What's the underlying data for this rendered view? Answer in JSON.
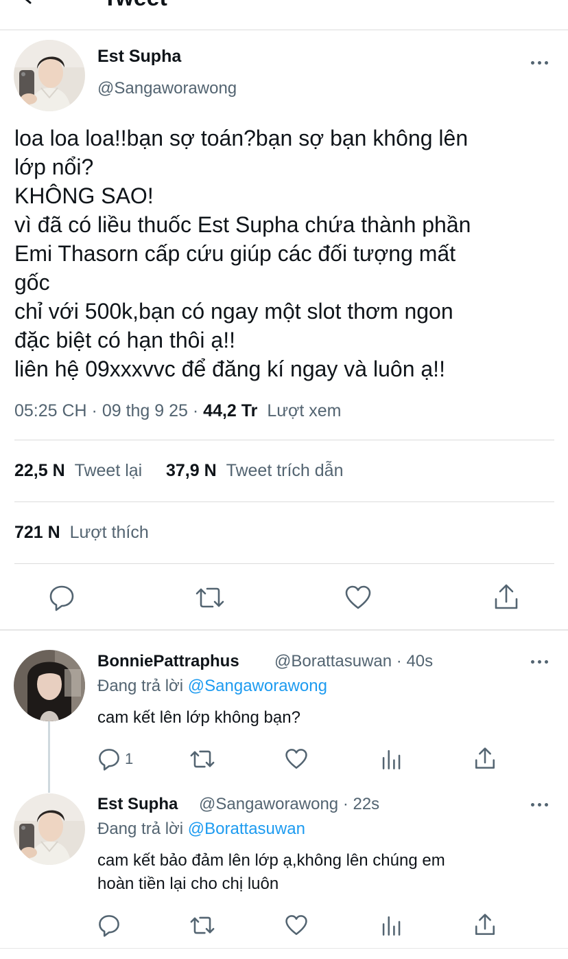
{
  "nav": {
    "title": "Tweet"
  },
  "tweet": {
    "author_name": "Est Supha",
    "author_handle": "@Sangaworawong",
    "text_lines": [
      "loa loa loa!!bạn sợ toán?bạn sợ bạn không lên",
      "lớp nổi?",
      "KHÔNG SAO!",
      "vì đã có liều thuốc Est Supha chứa thành phần",
      "Emi Thasorn cấp cứu giúp các đối tượng mất",
      "gốc",
      "chỉ với 500k,bạn có ngay một slot thơm ngon",
      "đặc biệt có hạn thôi ạ!!",
      "liên hệ 09xxxvvc để đăng kí ngay và luôn ạ!!"
    ],
    "time": "05:25 CH · 09 thg 9 25 · ",
    "views_count": "44,2 Tr",
    "views_label": "Lượt xem",
    "retweets_count": "22,5 N",
    "retweets_label": "Tweet lại",
    "quotes_count": "37,9 N",
    "quotes_label": "Tweet trích dẫn",
    "likes_count": "721 N",
    "likes_label": "Lượt thích"
  },
  "icons": {
    "reply": "reply-icon",
    "retweet": "retweet-icon",
    "like": "heart-icon",
    "share": "share-icon",
    "analytics": "analytics-icon",
    "more": "more-icon"
  },
  "colors": {
    "link": "#1d9bf0",
    "secondary_text": "#536471",
    "divider": "#dcdcdc"
  },
  "replies": [
    {
      "name": "BonniePattraphus",
      "handle": "@Borattasuwan",
      "time": "· 40s",
      "replying_label": "Đang trả lời",
      "replying_to": "@Sangaworawong",
      "text_lines": [
        "cam kết lên lớp không bạn?"
      ],
      "reply_count": "1"
    },
    {
      "name": "Est Supha",
      "handle": "@Sangaworawong",
      "time": "· 22s",
      "replying_label": "Đang trả lời",
      "replying_to": "@Borattasuwan",
      "text_lines": [
        "cam kết bảo đảm lên lớp ạ,không lên chúng em",
        "hoàn tiền lại cho chị luôn"
      ],
      "reply_count": ""
    }
  ]
}
